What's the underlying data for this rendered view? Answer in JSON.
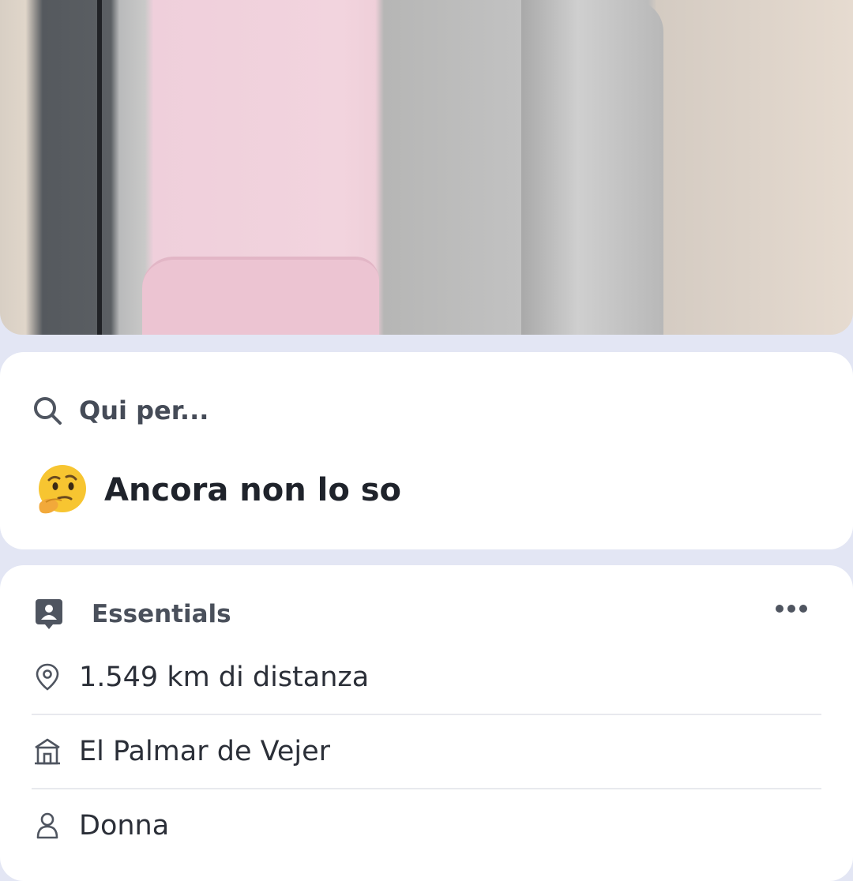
{
  "intent": {
    "label": "Qui per...",
    "value": "Ancora non lo so",
    "emoji_icon": "thinking-face-icon"
  },
  "essentials": {
    "title": "Essentials",
    "rows": [
      {
        "icon": "location-pin-icon",
        "text": "1.549 km di distanza"
      },
      {
        "icon": "home-icon",
        "text": "El Palmar de Vejer"
      },
      {
        "icon": "person-icon",
        "text": "Donna"
      }
    ]
  },
  "colors": {
    "background": "#e3e6f4",
    "card": "#ffffff",
    "text_primary": "#1f232b",
    "text_secondary": "#4a505b"
  }
}
